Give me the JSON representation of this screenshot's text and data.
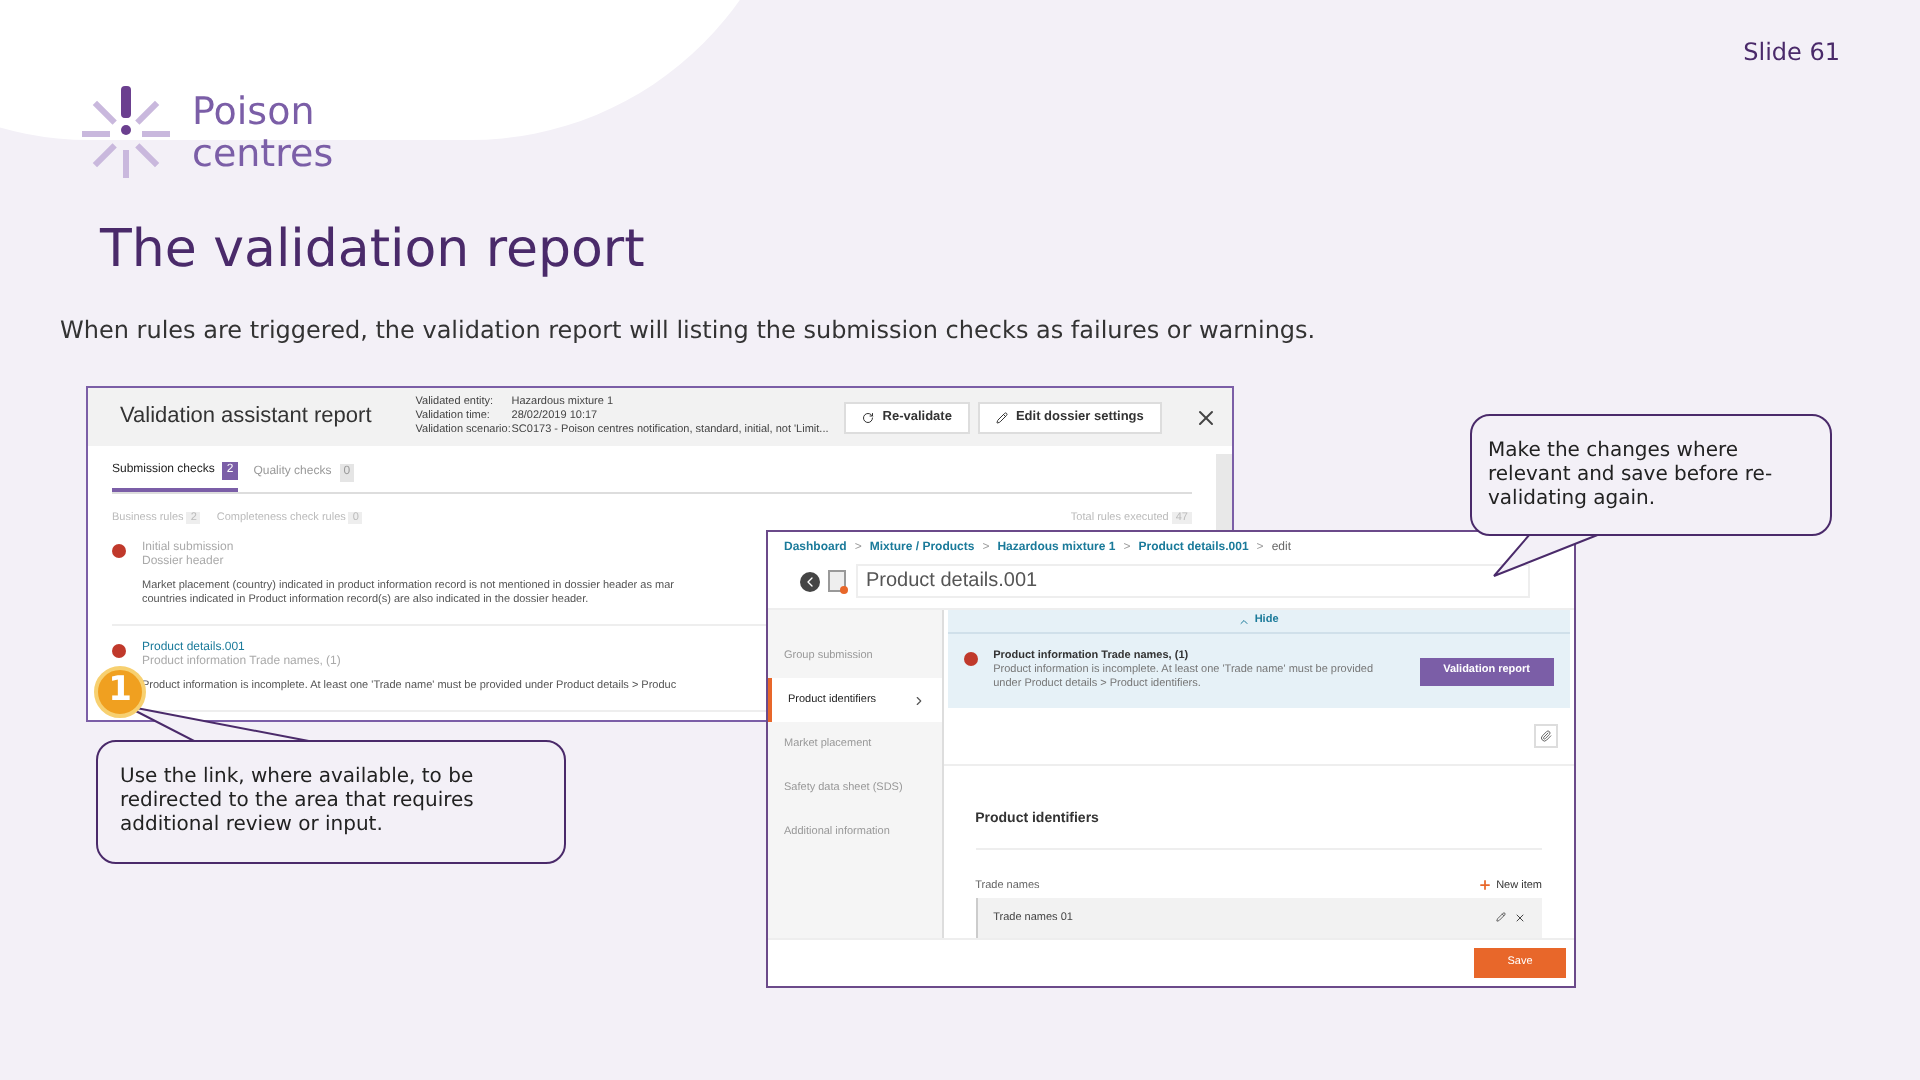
{
  "slide_number": "Slide 61",
  "logo": {
    "lines": [
      "Poison",
      "centres"
    ]
  },
  "title": "The validation report",
  "intro": "When rules are triggered, the validation report will listing the submission checks as failures or warnings.",
  "report": {
    "title": "Validation assistant report",
    "meta": [
      {
        "label": "Validated entity:",
        "value": "Hazardous mixture 1"
      },
      {
        "label": "Validation time:",
        "value": "28/02/2019 10:17"
      },
      {
        "label": "Validation scenario:",
        "value": "SC0173 - Poison centres notification, standard, initial, not 'Limit..."
      }
    ],
    "buttons": [
      {
        "label": "Re-validate",
        "kind": "refresh"
      },
      {
        "label": "Edit dossier settings",
        "kind": "edit"
      }
    ],
    "tabs": [
      {
        "label": "Submission checks",
        "count": "2",
        "selected": true
      },
      {
        "label": "Quality checks",
        "count": "0",
        "selected": false
      }
    ],
    "rule_counts": [
      {
        "label": "Business rules",
        "count": "2"
      },
      {
        "label": "Completeness check rules",
        "count": "0"
      }
    ],
    "total": {
      "label": "Total rules executed",
      "count": "47"
    },
    "items": [
      {
        "title": "Initial submission",
        "link": false,
        "subtitle": "Dossier header",
        "message": [
          "Market placement (country) indicated in product information record is not mentioned in dossier header as mar",
          "countries indicated in Product information record(s) are also indicated in the dossier header."
        ]
      },
      {
        "title": "Product details.001",
        "link": true,
        "subtitle": "Product information Trade names, (1)",
        "message": [
          "Product information is incomplete. At least one 'Trade name' must be provided under Product details > Produc"
        ]
      }
    ]
  },
  "editor": {
    "separator": ">",
    "breadcrumb": [
      {
        "label": "Dashboard",
        "link": true
      },
      {
        "label": "Mixture / Products",
        "link": true
      },
      {
        "label": "Hazardous mixture 1",
        "link": true
      },
      {
        "label": "Product details.001",
        "link": true
      },
      {
        "label": "edit",
        "link": false
      }
    ],
    "title": "Product details.001",
    "nav": [
      {
        "label": "Group submission",
        "selected": false
      },
      {
        "label": "Product identifiers",
        "selected": true
      },
      {
        "label": "Market placement",
        "selected": false
      },
      {
        "label": "Safety data sheet (SDS)",
        "selected": false
      },
      {
        "label": "Additional information",
        "selected": false
      }
    ],
    "hide_toggle": "Hide",
    "error": {
      "title": "Product information Trade names, (1)",
      "message": "Product information is incomplete. At least one 'Trade name' must be provided under Product details > Product identifiers."
    },
    "report_button": "Validation report",
    "section_title": "Product identifiers",
    "field_label": "Trade names",
    "new_item": "New item",
    "rows": [
      "Trade names 01"
    ],
    "save": "Save"
  },
  "badge": "1",
  "callouts": [
    "Use the link, where available, to be redirected to the area that requires additional review or input.",
    "Make the changes where relevant and save before re-validating again."
  ]
}
